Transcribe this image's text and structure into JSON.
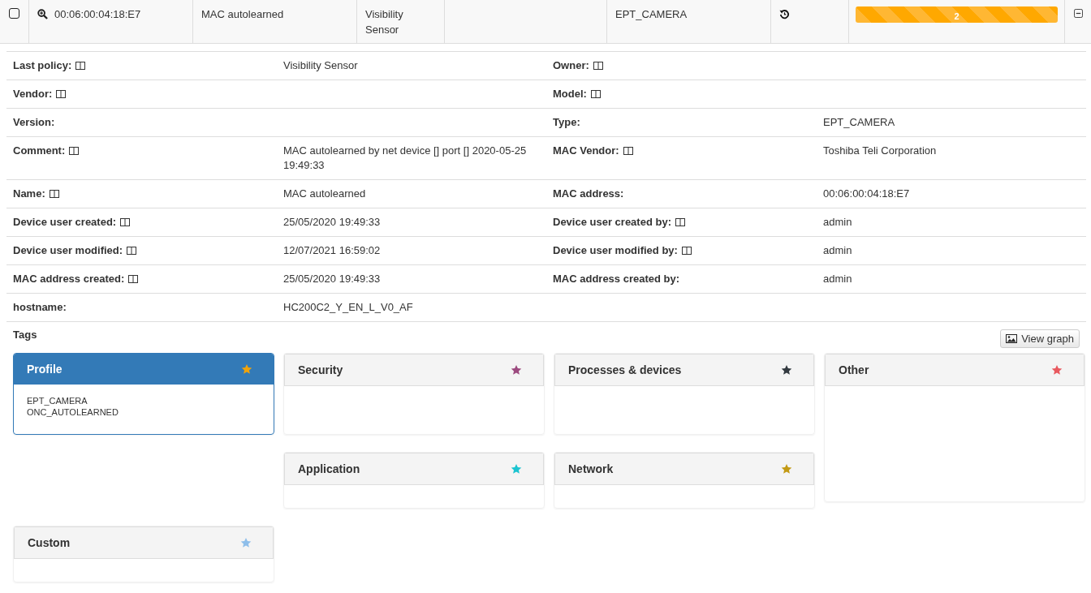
{
  "device_row": {
    "checked": false,
    "mac": "00:06:00:04:18:E7",
    "name": "MAC autolearned",
    "policy": "Visibility Sensor",
    "type": "EPT_CAMERA",
    "progress": {
      "level": 1,
      "label": "2"
    }
  },
  "details": [
    {
      "left": {
        "label": "Last policy:",
        "editable": true,
        "value": "Visibility Sensor"
      },
      "right": {
        "label": "Owner:",
        "editable": true
      }
    },
    {
      "left": {
        "label": "Vendor:",
        "editable": true
      },
      "right": {
        "label": "Model:",
        "editable": true
      }
    },
    {
      "left": {
        "label": "Version:",
        "editable": false
      },
      "right": {
        "label": "Type:",
        "editable": false,
        "value": "EPT_CAMERA"
      }
    },
    {
      "left": {
        "label": "Comment:",
        "editable": true,
        "value": "MAC autolearned by net device [] port [] 2020-05-25 19:49:33"
      },
      "right": {
        "label": "MAC Vendor:",
        "editable": true,
        "value": "Toshiba Teli Corporation"
      }
    },
    {
      "left": {
        "label": "Name:",
        "editable": true,
        "value": "MAC autolearned"
      },
      "right": {
        "label": "MAC address:",
        "editable": false,
        "value": "00:06:00:04:18:E7"
      }
    },
    {
      "left": {
        "label": "Device user created:",
        "editable": true,
        "value": "25/05/2020 19:49:33"
      },
      "right": {
        "label": "Device user created by:",
        "editable": true,
        "value": "admin"
      }
    },
    {
      "left": {
        "label": "Device user modified:",
        "editable": true,
        "value": "12/07/2021 16:59:02"
      },
      "right": {
        "label": "Device user modified by:",
        "editable": true,
        "value": "admin"
      }
    },
    {
      "left": {
        "label": "MAC address created:",
        "editable": true,
        "value": "25/05/2020 19:49:33"
      },
      "right": {
        "label": "MAC address created by:",
        "editable": false,
        "value": "admin"
      }
    },
    {
      "left": {
        "label": "hostname:",
        "editable": false,
        "value": "HC200C2_Y_EN_L_V0_AF"
      }
    }
  ],
  "tags": {
    "title": "Tags",
    "view_graph": "View graph",
    "cards": [
      {
        "title": "Profile",
        "selected": true,
        "color": "#f0a30a",
        "items": [
          "EPT_CAMERA",
          "ONC_AUTOLEARNED"
        ]
      },
      {
        "title": "Security",
        "selected": false,
        "color": "#9c4a7f"
      },
      {
        "title": "Processes & devices",
        "selected": false,
        "color": "#333a40"
      },
      {
        "title": "Other",
        "selected": false,
        "color": "#e8595f"
      },
      {
        "title": "Application",
        "selected": false,
        "color": "#1cc4d0"
      },
      {
        "title": "Network",
        "selected": false,
        "color": "#c39a14"
      },
      {
        "title": "Custom",
        "selected": false,
        "color": "#8ebeea"
      }
    ]
  }
}
